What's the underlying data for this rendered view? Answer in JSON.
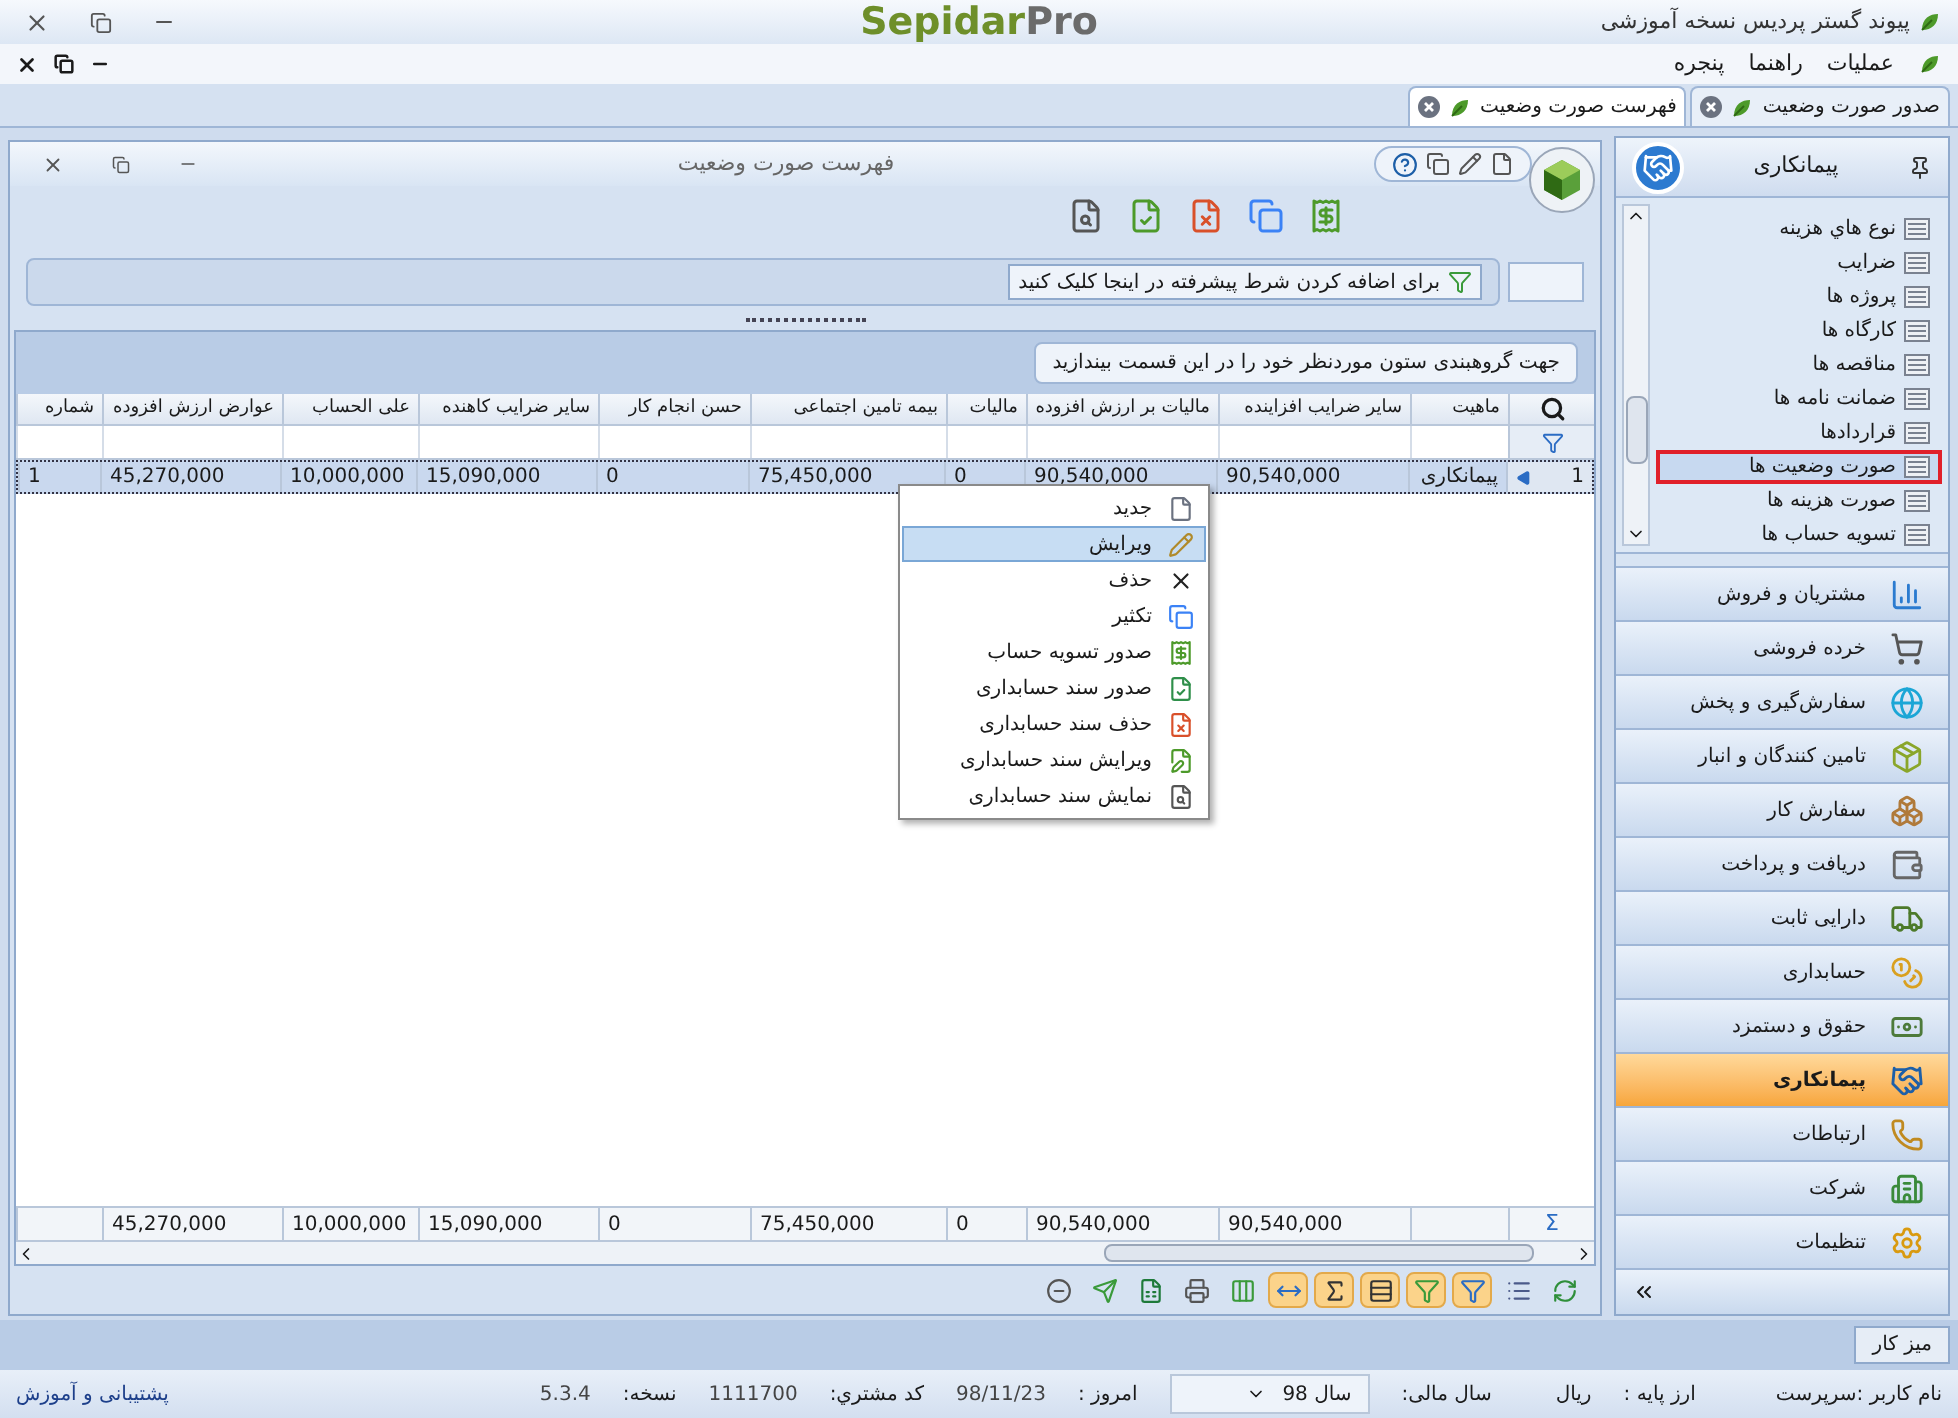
{
  "window": {
    "title": "پیوند گستر پردیس نسخه آموزشی",
    "logo": {
      "part1": "Sepidar",
      "part2": "Pro"
    }
  },
  "menu": [
    "عملیات",
    "راهنما",
    "پنجره"
  ],
  "tabs": [
    {
      "label": "صدور صورت وضعیت",
      "selected": false
    },
    {
      "label": "فهرست صورت وضعیت",
      "selected": true
    }
  ],
  "list_window": {
    "title": "فهرست صورت وضعیت",
    "filter_hint": "برای اضافه کردن شرط پیشرفته در اینجا کلیک کنید",
    "group_hint": "جهت گروهبندی ستون موردنظر خود را در این قسمت بیندازید",
    "columns": [
      "ماهیت",
      "سایر ضرایب افزاینده",
      "مالیات بر ارزش افزوده",
      "مالیات",
      "بیمه تامین اجتماعی",
      "حسن انجام کار",
      "سایر ضرایب کاهنده",
      "علی الحساب",
      "عوارض ارزش افزوده",
      "شماره"
    ],
    "rows": [
      {
        "indicator": "1",
        "selected": true,
        "cells": [
          "پیمانکاری",
          "90,540,000",
          "90,540,000",
          "0",
          "75,450,000",
          "0",
          "15,090,000",
          "10,000,000",
          "45,270,000",
          "1"
        ]
      }
    ],
    "totals": {
      "label": "Σ",
      "values": [
        "90,540,000",
        "90,540,000",
        "0",
        "75,450,000",
        "0",
        "15,090,000",
        "10,000,000",
        "45,270,000"
      ]
    },
    "grid_tools": [
      {
        "kind": "refresh",
        "on": false
      },
      {
        "kind": "rows",
        "on": false
      },
      {
        "kind": "filter",
        "on": true
      },
      {
        "kind": "filter2",
        "on": true
      },
      {
        "kind": "panel",
        "on": true
      },
      {
        "kind": "sum",
        "on": true
      },
      {
        "kind": "width",
        "on": true
      },
      {
        "kind": "columns",
        "on": false
      },
      {
        "kind": "print",
        "on": false
      },
      {
        "kind": "excel",
        "on": false
      },
      {
        "kind": "send",
        "on": false
      },
      {
        "kind": "circle",
        "on": false
      }
    ]
  },
  "context_menu": [
    {
      "kind": "new",
      "label": "جدید",
      "selected": false
    },
    {
      "kind": "edit",
      "label": "ویرایش",
      "selected": true
    },
    {
      "kind": "delete",
      "label": "حذف",
      "selected": false
    },
    {
      "kind": "copy",
      "label": "تکثیر",
      "selected": false
    },
    {
      "kind": "settle",
      "label": "صدور تسویه حساب",
      "selected": false
    },
    {
      "kind": "issue",
      "label": "صدور سند حسابداری",
      "selected": false
    },
    {
      "kind": "unpost",
      "label": "حذف سند حسابداری",
      "selected": false
    },
    {
      "kind": "repost",
      "label": "ویرایش سند حسابداری",
      "selected": false
    },
    {
      "kind": "view",
      "label": "نمایش سند حسابداری",
      "selected": false
    }
  ],
  "sidebar": {
    "title": "پیمانکاری",
    "items": [
      {
        "label": "نوع هاي هزینه",
        "selected": false
      },
      {
        "label": "ضرایب",
        "selected": false
      },
      {
        "label": "پروژه ها",
        "selected": false
      },
      {
        "label": "کارگاه ها",
        "selected": false
      },
      {
        "label": "مناقصه ها",
        "selected": false
      },
      {
        "label": "ضمانت نامه ها",
        "selected": false
      },
      {
        "label": "قراردادها",
        "selected": false
      },
      {
        "label": "صورت وضعیت ها",
        "selected": true
      },
      {
        "label": "صورت هزینه ها",
        "selected": false
      },
      {
        "label": "تسویه حساب ها",
        "selected": false
      }
    ],
    "modules": [
      {
        "kind": "sales",
        "label": "مشتریان و فروش",
        "selected": false
      },
      {
        "kind": "retail",
        "label": "خرده فروشی",
        "selected": false
      },
      {
        "kind": "distribution",
        "label": "سفارش‌گیری و پخش",
        "selected": false
      },
      {
        "kind": "suppliers",
        "label": "تامین کنندگان و انبار",
        "selected": false
      },
      {
        "kind": "order",
        "label": "سفارش کار",
        "selected": false
      },
      {
        "kind": "payments",
        "label": "دریافت و پرداخت",
        "selected": false
      },
      {
        "kind": "assets",
        "label": "دارایی ثابت",
        "selected": false
      },
      {
        "kind": "accounting",
        "label": "حسابداری",
        "selected": false
      },
      {
        "kind": "payroll",
        "label": "حقوق و دستمزد",
        "selected": false
      },
      {
        "kind": "contracting",
        "label": "پیمانکاری",
        "selected": true
      },
      {
        "kind": "communication",
        "label": "ارتباطات",
        "selected": false
      },
      {
        "kind": "company",
        "label": "شرکت",
        "selected": false
      },
      {
        "kind": "settings",
        "label": "تنظیمات",
        "selected": false
      }
    ]
  },
  "desktop_button": "میز کار",
  "status_bar": {
    "user": "نام کاربر :سرپرست",
    "currency_label": "ارز پایه :",
    "currency": "ریال",
    "year_label": "سال مالی:",
    "year": "سال 98",
    "today_label": "امروز :",
    "today": "98/11/23",
    "customer_label": "کد مشتري:",
    "customer": "1111700",
    "version_label": "نسخه:",
    "version": "5.3.4",
    "support": "پشتیبانی و آموزش"
  }
}
